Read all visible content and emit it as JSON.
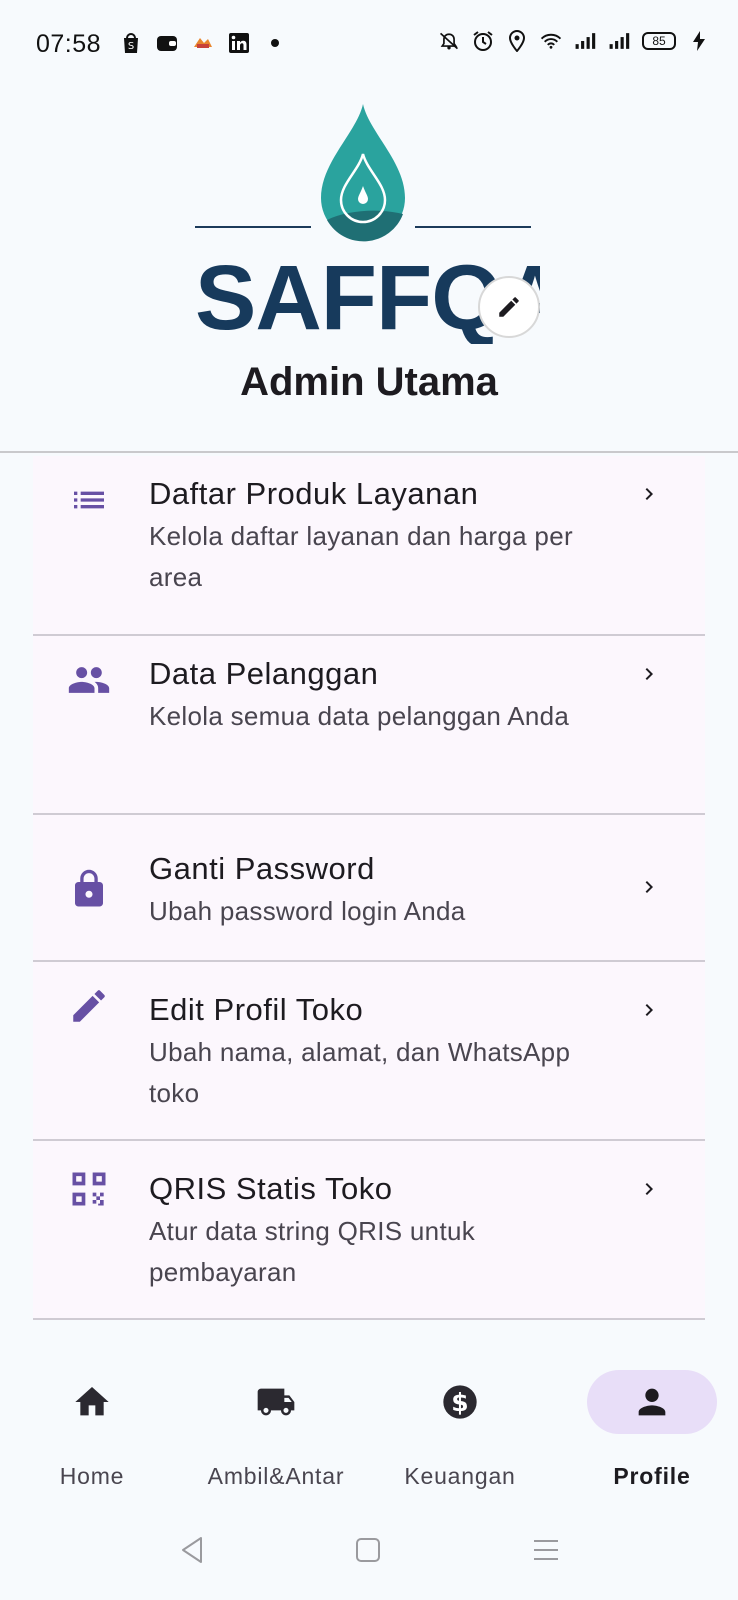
{
  "status_bar": {
    "time": "07:58",
    "battery": "85",
    "left_icons": [
      "shopping-bag-icon",
      "wallet-icon",
      "game-icon",
      "linkedin-icon",
      "dot-icon"
    ],
    "right_icons": [
      "silent-icon",
      "alarm-icon",
      "location-icon",
      "wifi-icon",
      "signal-icon",
      "signal-icon",
      "battery-icon",
      "charging-icon"
    ]
  },
  "header": {
    "logo_text": "SAFFQA",
    "profile_name": "Admin Utama",
    "edit_icon": "pencil-icon",
    "brand_colors": {
      "teal": "#2aa39e",
      "navy": "#173a5c"
    }
  },
  "menu": {
    "items": [
      {
        "icon": "list-icon",
        "title": "Daftar Produk Layanan",
        "subtitle": "Kelola daftar layanan dan harga per area"
      },
      {
        "icon": "people-icon",
        "title": "Data Pelanggan",
        "subtitle": "Kelola semua data pelanggan Anda"
      },
      {
        "icon": "lock-icon",
        "title": "Ganti Password",
        "subtitle": "Ubah password login Anda"
      },
      {
        "icon": "edit-icon",
        "title": "Edit Profil Toko",
        "subtitle": "Ubah nama, alamat, dan WhatsApp toko"
      },
      {
        "icon": "qr-code-icon",
        "title": "QRIS Statis Toko",
        "subtitle": "Atur data string QRIS untuk pembayaran"
      }
    ],
    "accent_color": "#6750a4"
  },
  "bottom_nav": {
    "items": [
      {
        "icon": "home-icon",
        "label": "Home"
      },
      {
        "icon": "truck-icon",
        "label": "Ambil&Antar"
      },
      {
        "icon": "dollar-icon",
        "label": "Keuangan"
      },
      {
        "icon": "person-icon",
        "label": "Profile"
      }
    ],
    "active": "Profile"
  }
}
